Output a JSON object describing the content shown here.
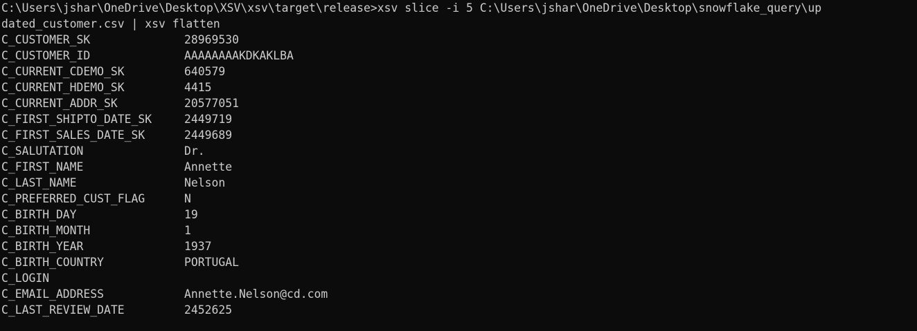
{
  "terminal": {
    "command_line_1": "C:\\Users\\jshar\\OneDrive\\Desktop\\XSV\\xsv\\target\\release>xsv slice -i 5 C:\\Users\\jshar\\OneDrive\\Desktop\\snowflake_query\\up",
    "command_line_2": "dated_customer.csv | xsv flatten",
    "rows": [
      {
        "field": "C_CUSTOMER_SK",
        "value": "28969530"
      },
      {
        "field": "C_CUSTOMER_ID",
        "value": "AAAAAAAAKDKAKLBA"
      },
      {
        "field": "C_CURRENT_CDEMO_SK",
        "value": "640579"
      },
      {
        "field": "C_CURRENT_HDEMO_SK",
        "value": "4415"
      },
      {
        "field": "C_CURRENT_ADDR_SK",
        "value": "20577051"
      },
      {
        "field": "C_FIRST_SHIPTO_DATE_SK",
        "value": "2449719"
      },
      {
        "field": "C_FIRST_SALES_DATE_SK",
        "value": "2449689"
      },
      {
        "field": "C_SALUTATION",
        "value": "Dr."
      },
      {
        "field": "C_FIRST_NAME",
        "value": "Annette"
      },
      {
        "field": "C_LAST_NAME",
        "value": "Nelson"
      },
      {
        "field": "C_PREFERRED_CUST_FLAG",
        "value": "N"
      },
      {
        "field": "C_BIRTH_DAY",
        "value": "19"
      },
      {
        "field": "C_BIRTH_MONTH",
        "value": "1"
      },
      {
        "field": "C_BIRTH_YEAR",
        "value": "1937"
      },
      {
        "field": "C_BIRTH_COUNTRY",
        "value": "PORTUGAL"
      },
      {
        "field": "C_LOGIN",
        "value": ""
      },
      {
        "field": "C_EMAIL_ADDRESS",
        "value": "Annette.Nelson@cd.com"
      },
      {
        "field": "C_LAST_REVIEW_DATE",
        "value": "2452625"
      }
    ]
  },
  "colors": {
    "background": "#0c0c0c",
    "foreground": "#cccccc"
  }
}
